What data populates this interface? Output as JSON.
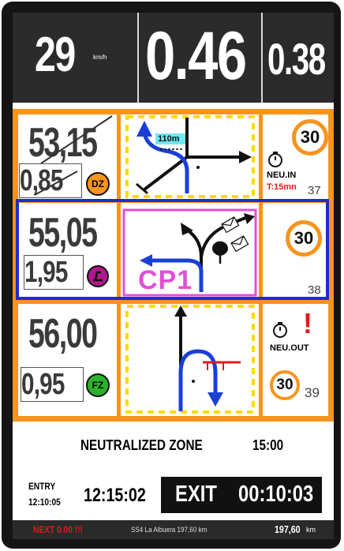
{
  "topbar": {
    "speed": "29",
    "speed_unit": "km/h",
    "distance": "0.46",
    "cap": "0.38"
  },
  "rows": [
    {
      "total_km": "53,15",
      "partial_km": "0,85",
      "badge_text": "DZ",
      "badge_color": "#f7941d",
      "distance_label": "110m",
      "speed_limit": "30",
      "zone_label": "NEU.IN",
      "zone_time": "T:15mn",
      "note_number": "37"
    },
    {
      "total_km": "55,05",
      "partial_km": "1,95",
      "badge_color": "#b0178c",
      "checkpoint_label": "CP1",
      "speed_limit": "30",
      "note_number": "38"
    },
    {
      "total_km": "56,00",
      "partial_km": "0,95",
      "badge_text": "FZ",
      "badge_color": "#2bb22b",
      "zone_label": "NEU.OUT",
      "warning": "!",
      "speed_limit": "30",
      "note_number": "39"
    }
  ],
  "neutral": {
    "title": "NEUTRALIZED ZONE",
    "duration": "15:00",
    "entry_label": "ENTRY",
    "entry_time": "12:10:05",
    "entry_clock": "12:15:02",
    "exit_label": "EXIT",
    "exit_time": "00:10:03"
  },
  "status": {
    "next_label": "NEXT 0.00 !!!",
    "stage_label": "SS4 La Albuera 197,60 km",
    "odometer": "197,60",
    "odometer_unit": "km"
  },
  "colors": {
    "frame_orange": "#f7941d",
    "highlight_blue": "#1a2fd1",
    "checkpoint_magenta": "#e04fd6",
    "route_blue": "#1a3fd8",
    "alert_red": "#e11b1b",
    "label_cyan": "#6fe8f2"
  },
  "icons": [
    "stopwatch-icon",
    "stopwatch-icon",
    "warning-icon",
    "tree-icon",
    "envelope-icon"
  ]
}
